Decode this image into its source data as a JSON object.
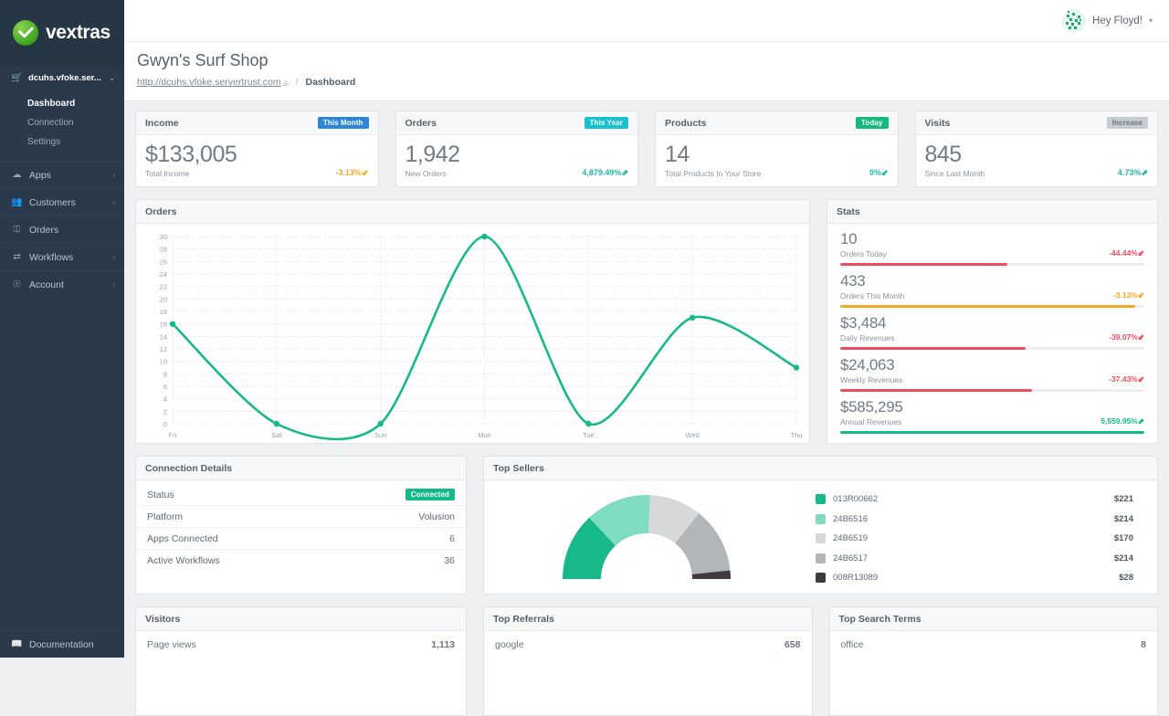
{
  "brand": {
    "name": "vextras",
    "logo_icon": "check-circle-logo"
  },
  "sidebar": {
    "store": {
      "label": "dcuhs.vfoke.ser...",
      "icon": "cart-icon",
      "caret": "⌄"
    },
    "subnav": [
      {
        "label": "Dashboard",
        "active": true
      },
      {
        "label": "Connection",
        "active": false
      },
      {
        "label": "Settings",
        "active": false
      }
    ],
    "nav": [
      {
        "label": "Apps",
        "icon": "cloud-icon",
        "chevron": "‹"
      },
      {
        "label": "Customers",
        "icon": "users-icon",
        "chevron": "‹"
      },
      {
        "label": "Orders",
        "icon": "bag-icon",
        "chevron": ""
      },
      {
        "label": "Workflows",
        "icon": "shuffle-icon",
        "chevron": "‹"
      },
      {
        "label": "Account",
        "icon": "user-circle-icon",
        "chevron": "‹"
      }
    ],
    "footer": {
      "label": "Documentation",
      "icon": "book-icon"
    }
  },
  "topbar": {
    "greeting": "Hey Floyd!",
    "caret": "▾",
    "avatar_icon": "user-avatar"
  },
  "page": {
    "title": "Gwyn's Surf Shop",
    "url": "http://dcuhs.vfoke.servertrust.com",
    "external_icon": "external-link-icon",
    "separator": "/",
    "crumb": "Dashboard"
  },
  "stat_cards": [
    {
      "title": "Income",
      "badge": "This Month",
      "badge_color": "#2e86d4",
      "value": "$133,005",
      "label": "Total Income",
      "pct": "-3.13%",
      "pct_color": "#f0ad2e",
      "arrow": "⬋"
    },
    {
      "title": "Orders",
      "badge": "This Year",
      "badge_color": "#17c1cf",
      "value": "1,942",
      "label": "New Orders",
      "pct": "4,879.49%",
      "pct_color": "#22b8a6",
      "arrow": "⬈"
    },
    {
      "title": "Products",
      "badge": "Today",
      "badge_color": "#17b97e",
      "value": "14",
      "label": "Total Products In Your Store",
      "pct": "0%",
      "pct_color": "#22b8a6",
      "arrow": "⬋"
    },
    {
      "title": "Visits",
      "badge": "Increase",
      "badge_color": "#c6ccd1",
      "badge_text_color": "#6b747b",
      "value": "845",
      "label": "Since Last Month",
      "pct": "4.73%",
      "pct_color": "#22b8a6",
      "arrow": "⬈"
    }
  ],
  "orders_panel": {
    "title": "Orders"
  },
  "stats_panel": {
    "title": "Stats",
    "items": [
      {
        "value": "10",
        "label": "Orders Today",
        "pct": "-44.44%",
        "arrow": "⬋",
        "color": "#ef4d5e",
        "fill": 55
      },
      {
        "value": "433",
        "label": "Orders This Month",
        "pct": "-3.13%",
        "arrow": "⬋",
        "color": "#f5a623",
        "fill": 97
      },
      {
        "value": "$3,484",
        "label": "Daily Revenues",
        "pct": "-39.07%",
        "arrow": "⬋",
        "color": "#ef4d5e",
        "fill": 61
      },
      {
        "value": "$24,063",
        "label": "Weekly Revenues",
        "pct": "-37.43%",
        "arrow": "⬋",
        "color": "#ef4d5e",
        "fill": 63
      },
      {
        "value": "$585,295",
        "label": "Annual Revenues",
        "pct": "5,559.95%",
        "arrow": "⬈",
        "color": "#14b98a",
        "fill": 100
      }
    ]
  },
  "connection_panel": {
    "title": "Connection Details",
    "rows": [
      {
        "key": "Status",
        "value": "Connected",
        "is_badge": true,
        "badge_color": "#14b98a"
      },
      {
        "key": "Platform",
        "value": "Volusion"
      },
      {
        "key": "Apps Connected",
        "value": "6"
      },
      {
        "key": "Active Workflows",
        "value": "36"
      }
    ]
  },
  "top_sellers_panel": {
    "title": "Top Sellers",
    "legend": [
      {
        "name": "013R00662",
        "amount": "$221",
        "color": "#17b98a"
      },
      {
        "name": "24B6516",
        "amount": "$214",
        "color": "#7fdcc1"
      },
      {
        "name": "24B6519",
        "amount": "$170",
        "color": "#d6d8d9"
      },
      {
        "name": "24B6517",
        "amount": "$214",
        "color": "#b3b6b8"
      },
      {
        "name": "008R13089",
        "amount": "$28",
        "color": "#3e3a3d"
      }
    ]
  },
  "bottom_panels": [
    {
      "title": "Visitors",
      "rows": [
        {
          "label": "Page views",
          "amount": "1,113"
        }
      ]
    },
    {
      "title": "Top Referrals",
      "rows": [
        {
          "label": "google",
          "amount": "658"
        }
      ]
    },
    {
      "title": "Top Search Terms",
      "rows": [
        {
          "label": "office",
          "amount": "8"
        }
      ]
    }
  ],
  "chart_data": {
    "type": "line",
    "title": "Orders",
    "categories": [
      "Fri",
      "Sat",
      "Sun",
      "Mon",
      "Tue",
      "Wed",
      "Thu"
    ],
    "values": [
      16,
      0,
      0,
      30,
      0,
      17,
      9
    ],
    "yticks": [
      0,
      2,
      4,
      6,
      8,
      10,
      12,
      14,
      16,
      18,
      20,
      22,
      24,
      26,
      28,
      30
    ],
    "ylim": [
      0,
      30
    ],
    "xlabel": "",
    "ylabel": "",
    "grid": true,
    "legend": "none",
    "line_color": "#17b98a",
    "smooth": true
  },
  "donut_data": {
    "type": "pie",
    "shape": "half-donut",
    "categories": [
      "013R00662",
      "24B6516",
      "24B6519",
      "24B6517",
      "008R13089"
    ],
    "values": [
      221,
      214,
      170,
      214,
      28
    ],
    "colors": [
      "#17b98a",
      "#7fdcc1",
      "#d6d8d9",
      "#b3b6b8",
      "#3e3a3d"
    ]
  }
}
